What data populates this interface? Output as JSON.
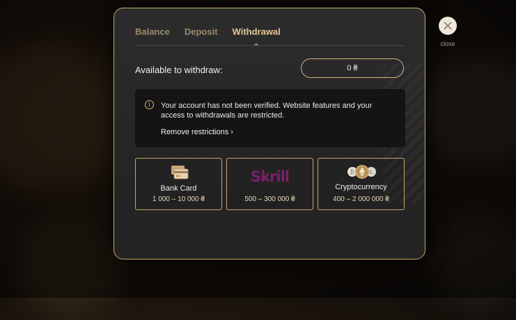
{
  "tabs": [
    {
      "label": "Balance"
    },
    {
      "label": "Deposit"
    },
    {
      "label": "Withdrawal"
    }
  ],
  "active_tab": "Withdrawal",
  "available": {
    "label": "Available to withdraw:",
    "value": "0 ₴"
  },
  "notice": {
    "icon": "info-icon",
    "text": "Your account has not been verified. Website features and your access to withdrawals are restricted.",
    "link": "Remove restrictions ›"
  },
  "methods": [
    {
      "name": "Bank Card",
      "range": "1 000 – 10 000 ₴",
      "icon": "bank-card-icon"
    },
    {
      "name": "Skrill",
      "logo_text": "Skrill",
      "range": "500 – 300 000 ₴",
      "icon": "skrill-logo"
    },
    {
      "name": "Cryptocurrency",
      "range": "400 – 2 000 000 ₴",
      "icon": "crypto-coins-icon"
    }
  ],
  "close": {
    "label": "close",
    "icon": "close-icon"
  },
  "colors": {
    "accent": "#d4b37a",
    "skrill": "#7a1f6b",
    "panel": "#141414"
  }
}
